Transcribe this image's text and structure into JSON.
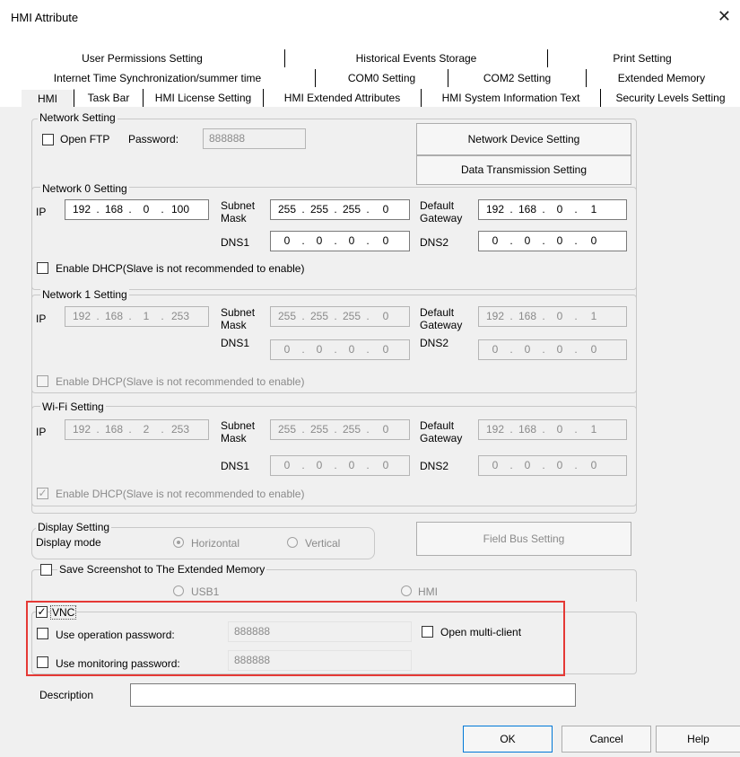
{
  "window": {
    "title": "HMI Attribute",
    "close_glyph": "✕"
  },
  "tabs": {
    "row1": [
      "User Permissions Setting",
      "Historical Events Storage",
      "Print Setting"
    ],
    "row2": [
      "Internet Time Synchronization/summer time",
      "COM0 Setting",
      "COM2 Setting",
      "Extended Memory"
    ],
    "row3": [
      "HMI",
      "Task Bar",
      "HMI License Setting",
      "HMI Extended Attributes",
      "HMI System Information Text",
      "Security Levels Setting"
    ],
    "active": "HMI"
  },
  "network": {
    "title": "Network Setting",
    "open_ftp_label": "Open FTP",
    "password_label": "Password:",
    "password_value": "888888",
    "device_button": "Network Device Setting",
    "transmission_button": "Data Transmission Setting"
  },
  "labels": {
    "ip": "IP",
    "subnet": "Subnet",
    "mask": "Mask",
    "default": "Default",
    "gateway": "Gateway",
    "dns1": "DNS1",
    "dns2": "DNS2",
    "dhcp": "Enable DHCP(Slave is not recommended to enable)"
  },
  "net0": {
    "title": "Network 0 Setting",
    "ip": [
      "192",
      "168",
      "0",
      "100"
    ],
    "mask": [
      "255",
      "255",
      "255",
      "0"
    ],
    "gateway": [
      "192",
      "168",
      "0",
      "1"
    ],
    "dns1": [
      "0",
      "0",
      "0",
      "0"
    ],
    "dns2": [
      "0",
      "0",
      "0",
      "0"
    ],
    "dhcp_checked": false
  },
  "net1": {
    "title": "Network 1 Setting",
    "ip": [
      "192",
      "168",
      "1",
      "253"
    ],
    "mask": [
      "255",
      "255",
      "255",
      "0"
    ],
    "gateway": [
      "192",
      "168",
      "0",
      "1"
    ],
    "dns1": [
      "0",
      "0",
      "0",
      "0"
    ],
    "dns2": [
      "0",
      "0",
      "0",
      "0"
    ],
    "dhcp_checked": false
  },
  "wifi": {
    "title": "Wi-Fi Setting",
    "ip": [
      "192",
      "168",
      "2",
      "253"
    ],
    "mask": [
      "255",
      "255",
      "255",
      "0"
    ],
    "gateway": [
      "192",
      "168",
      "0",
      "1"
    ],
    "dns1": [
      "0",
      "0",
      "0",
      "0"
    ],
    "dns2": [
      "0",
      "0",
      "0",
      "0"
    ],
    "dhcp_checked": true
  },
  "display": {
    "title": "Display Setting",
    "mode_label": "Display mode",
    "horizontal": "Horizontal",
    "vertical": "Vertical",
    "selected": "Horizontal"
  },
  "field_bus_button": "Field Bus Setting",
  "screenshot": {
    "label": "Save Screenshot to The Extended Memory",
    "usb1": "USB1",
    "hmi": "HMI"
  },
  "vnc": {
    "label": "VNC",
    "checked": true,
    "op_pw_label": "Use operation password:",
    "op_pw_value": "888888",
    "mon_pw_label": "Use monitoring password:",
    "mon_pw_value": "888888",
    "multi_client_label": "Open multi-client"
  },
  "description": {
    "label": "Description",
    "value": ""
  },
  "buttons": {
    "ok": "OK",
    "cancel": "Cancel",
    "help": "Help"
  }
}
